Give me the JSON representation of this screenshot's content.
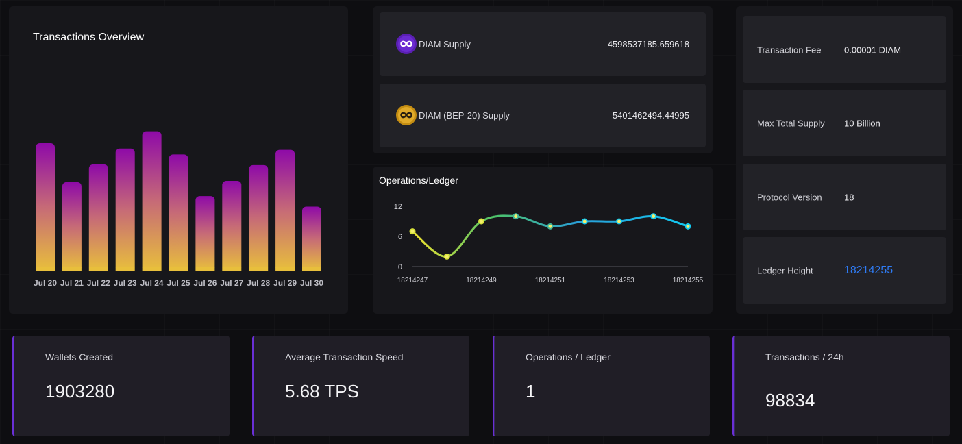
{
  "tx_overview": {
    "title": "Transactions Overview"
  },
  "chart_data": [
    {
      "type": "bar",
      "title": "Transactions Overview",
      "categories": [
        "Jul 20",
        "Jul 21",
        "Jul 22",
        "Jul 23",
        "Jul 24",
        "Jul 25",
        "Jul 26",
        "Jul 27",
        "Jul 28",
        "Jul 29",
        "Jul 30"
      ],
      "values": [
        193,
        134,
        161,
        185,
        211,
        176,
        113,
        136,
        160,
        183,
        97
      ],
      "ylim": [
        0,
        220
      ],
      "grid": false,
      "colors": {
        "top": "#8e0aa8",
        "mid": "#c66a77",
        "bottom": "#e8bf3c"
      }
    },
    {
      "type": "line",
      "title": "Operations/Ledger",
      "x": [
        "18214247",
        "18214248",
        "18214249",
        "18214250",
        "18214251",
        "18214252",
        "18214253",
        "18214254",
        "18214255"
      ],
      "x_tick_labels": [
        "18214247",
        "18214249",
        "18214251",
        "18214253",
        "18214255"
      ],
      "y": [
        7,
        2,
        9,
        10,
        8,
        9,
        9,
        10,
        8
      ],
      "y_ticks": [
        "0",
        "6",
        "12"
      ],
      "ylim": [
        0,
        12
      ],
      "grid": false,
      "colors": {
        "start": "#f0e22e",
        "mid": "#4cc36a",
        "end": "#12c8f0",
        "point_fill": "#f2ee6c"
      }
    }
  ],
  "supply": [
    {
      "label": "DIAM Supply",
      "value": "4598537185.659618",
      "icon": "infinity-coin-purple-icon",
      "color": "#5a1fb3"
    },
    {
      "label": "DIAM (BEP-20) Supply",
      "value": "5401462494.44995",
      "icon": "infinity-coin-gold-icon",
      "color": "#d9a21b"
    }
  ],
  "ops": {
    "title": "Operations/Ledger"
  },
  "info": [
    {
      "label": "Transaction Fee",
      "value": "0.00001 DIAM"
    },
    {
      "label": "Max Total Supply",
      "value": "10 Billion"
    },
    {
      "label": "Protocol Version",
      "value": "18"
    },
    {
      "label": "Ledger Height",
      "value": "18214255"
    }
  ],
  "stats": [
    {
      "label": "Wallets Created",
      "value": "1903280"
    },
    {
      "label": "Average Transaction Speed",
      "value": "5.68 TPS"
    },
    {
      "label": "Operations / Ledger",
      "value": "1"
    },
    {
      "label": "Transactions / 24h",
      "value": "98834"
    }
  ]
}
